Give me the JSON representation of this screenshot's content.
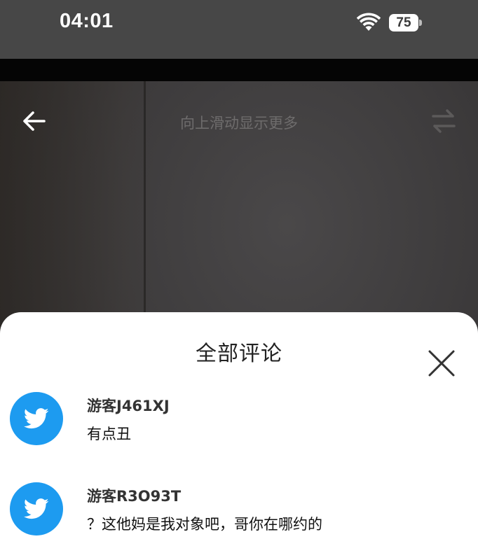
{
  "status_bar": {
    "time": "04:01",
    "battery": "75"
  },
  "header": {
    "swipe_hint": "向上滑动显示更多"
  },
  "comments_sheet": {
    "title": "全部评论",
    "comments": [
      {
        "user": "游客J461XJ",
        "text": "有点丑"
      },
      {
        "user": "游客R3O93T",
        "text": "？这他妈是我对象吧，哥你在哪约的"
      }
    ]
  },
  "icons": {
    "back": "back-arrow-icon",
    "switch": "switch-arrows-icon",
    "close": "close-icon",
    "avatar": "bird-icon",
    "wifi": "wifi-icon"
  },
  "colors": {
    "avatar_blue": "#1d9bf0",
    "sheet_bg": "#ffffff"
  }
}
